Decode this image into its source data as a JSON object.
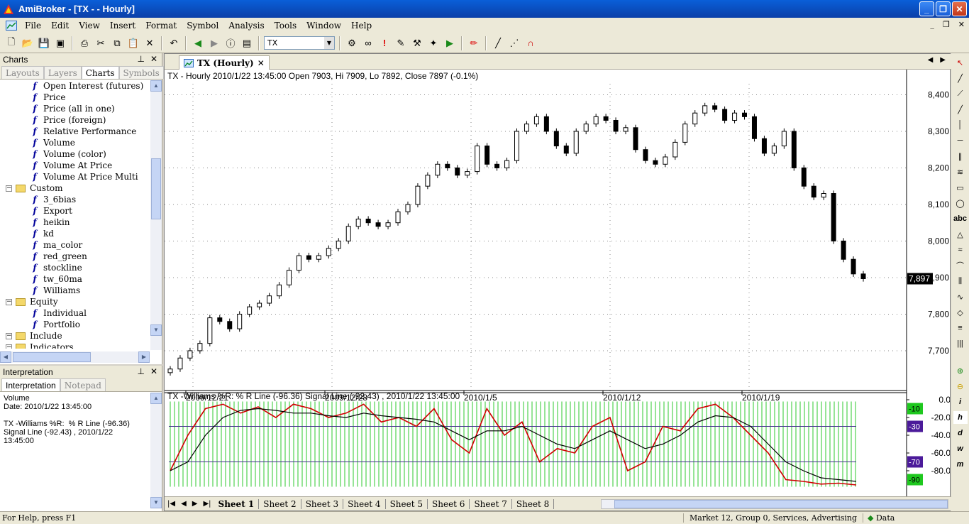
{
  "window": {
    "title": "AmiBroker - [TX -  - Hourly]"
  },
  "menu": [
    "File",
    "Edit",
    "View",
    "Insert",
    "Format",
    "Symbol",
    "Analysis",
    "Tools",
    "Window",
    "Help"
  ],
  "toolbar": {
    "symbol": "TX"
  },
  "charts_panel": {
    "title": "Charts",
    "tabs": [
      "Layouts",
      "Layers",
      "Charts",
      "Symbols"
    ],
    "active_tab": "Charts",
    "tree": [
      {
        "type": "f",
        "label": "Open Interest (futures)"
      },
      {
        "type": "f",
        "label": "Price"
      },
      {
        "type": "f",
        "label": "Price (all in one)"
      },
      {
        "type": "f",
        "label": "Price (foreign)"
      },
      {
        "type": "f",
        "label": "Relative Performance"
      },
      {
        "type": "f",
        "label": "Volume"
      },
      {
        "type": "f",
        "label": "Volume (color)"
      },
      {
        "type": "f",
        "label": "Volume At Price"
      },
      {
        "type": "f",
        "label": "Volume At Price Multi"
      },
      {
        "type": "folder",
        "label": "Custom"
      },
      {
        "type": "f",
        "label": "3_6bias"
      },
      {
        "type": "f",
        "label": "Export"
      },
      {
        "type": "f",
        "label": "heikin"
      },
      {
        "type": "f",
        "label": "kd"
      },
      {
        "type": "f",
        "label": "ma_color"
      },
      {
        "type": "f",
        "label": "red_green"
      },
      {
        "type": "f",
        "label": "stockline"
      },
      {
        "type": "f",
        "label": "tw_60ma"
      },
      {
        "type": "f",
        "label": "Williams"
      },
      {
        "type": "folder",
        "label": "Equity"
      },
      {
        "type": "f",
        "label": "Individual"
      },
      {
        "type": "f",
        "label": "Portfolio"
      },
      {
        "type": "folder",
        "label": "Include"
      },
      {
        "type": "folder",
        "label": "Indicators"
      }
    ]
  },
  "interpretation_panel": {
    "title": "Interpretation",
    "tabs": [
      "Interpretation",
      "Notepad"
    ],
    "text": "Volume\nDate: 2010/1/22 13:45:00\n\nTX -Williams %R:  % R Line (-96.36)\nSignal Line (-92.43) , 2010/1/22\n13:45:00"
  },
  "chart_window": {
    "tab_label": "TX (Hourly)",
    "price_title": "TX - Hourly 2010/1/22 13:45:00 Open 7903, Hi 7909, Lo 7892, Close 7897 (-0.1%)",
    "williams_title": "TX -Williams %R:  % R Line (-96.36)  Signal Line (-92.43) , 2010/1/22 13:45:00",
    "sheets": [
      "Sheet 1",
      "Sheet 2",
      "Sheet 3",
      "Sheet 4",
      "Sheet 5",
      "Sheet 6",
      "Sheet 7",
      "Sheet 8"
    ],
    "active_sheet": "Sheet 1"
  },
  "chart_data": [
    {
      "type": "candlestick",
      "title": "TX - Hourly 2010/1/22 13:45:00 Open 7903, Hi 7909, Lo 7892, Close 7897 (-0.1%)",
      "x_labels": [
        "2009/12/21",
        "2009/12/28",
        "2010/1/5",
        "2010/1/12",
        "2010/1/19"
      ],
      "y_ticks": [
        7700,
        7800,
        7900,
        8000,
        8100,
        8200,
        8300,
        8400
      ],
      "ylim": [
        7630,
        8430
      ],
      "last_value": "7,897",
      "closes": [
        7650,
        7680,
        7700,
        7720,
        7790,
        7780,
        7760,
        7800,
        7820,
        7830,
        7850,
        7880,
        7920,
        7960,
        7950,
        7960,
        7980,
        8000,
        8040,
        8060,
        8050,
        8040,
        8050,
        8080,
        8100,
        8150,
        8180,
        8210,
        8200,
        8180,
        8190,
        8260,
        8210,
        8200,
        8220,
        8300,
        8320,
        8340,
        8300,
        8260,
        8240,
        8300,
        8320,
        8340,
        8330,
        8300,
        8310,
        8250,
        8220,
        8210,
        8230,
        8270,
        8320,
        8350,
        8370,
        8360,
        8330,
        8350,
        8340,
        8280,
        8240,
        8260,
        8300,
        8200,
        8150,
        8120,
        8130,
        8000,
        7950,
        7910,
        7897
      ],
      "grid": true
    },
    {
      "type": "line",
      "title": "TX -Williams %R:  % R Line (-96.36)  Signal Line (-92.43) , 2010/1/22 13:45:00",
      "y_ticks": [
        0,
        -20,
        -40,
        -60,
        -80
      ],
      "ylim": [
        -100,
        0
      ],
      "levels": [
        -10,
        -30,
        -70,
        -90
      ],
      "series": [
        {
          "name": "% R Line",
          "color": "#d00000",
          "values": [
            -80,
            -40,
            -10,
            -5,
            -15,
            -8,
            -20,
            -5,
            -10,
            -20,
            -15,
            -5,
            -25,
            -20,
            -30,
            -10,
            -45,
            -60,
            -10,
            -40,
            -25,
            -70,
            -55,
            -60,
            -30,
            -20,
            -80,
            -70,
            -30,
            -35,
            -10,
            -5,
            -20,
            -40,
            -60,
            -90,
            -92,
            -95,
            -94,
            -96
          ]
        },
        {
          "name": "Signal Line",
          "color": "#000000",
          "values": [
            -80,
            -70,
            -40,
            -20,
            -12,
            -10,
            -12,
            -15,
            -15,
            -18,
            -20,
            -15,
            -18,
            -20,
            -22,
            -25,
            -35,
            -45,
            -35,
            -35,
            -30,
            -40,
            -50,
            -55,
            -45,
            -35,
            -45,
            -55,
            -50,
            -40,
            -25,
            -18,
            -20,
            -30,
            -50,
            -70,
            -80,
            -88,
            -90,
            -92
          ]
        }
      ]
    }
  ],
  "status_bar": {
    "help": "For Help, press F1",
    "market": "Market 12, Group 0, Services, Advertising",
    "data": "Data"
  }
}
